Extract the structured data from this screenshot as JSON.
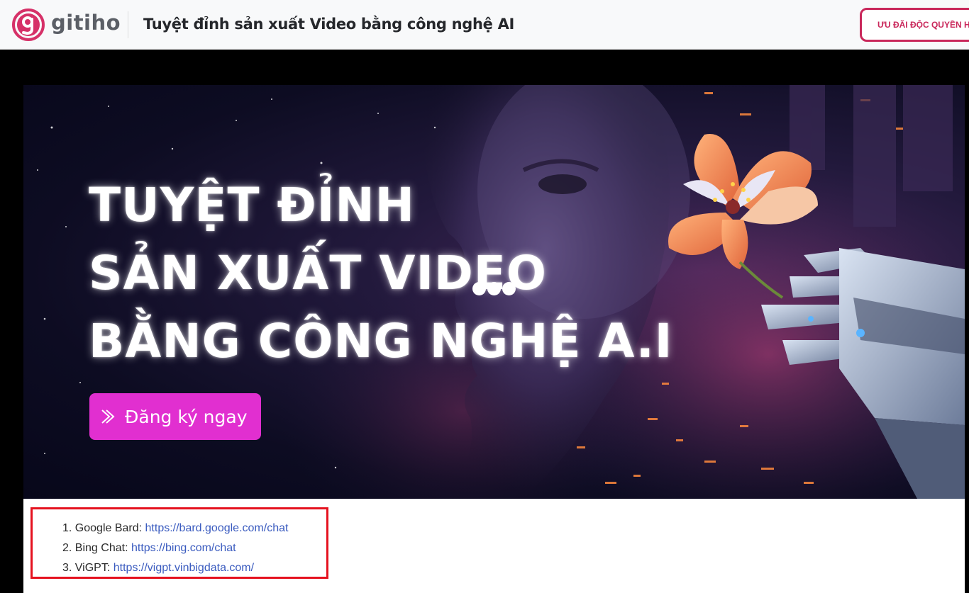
{
  "header": {
    "logo_text": "gitiho",
    "course_title": "Tuyệt đỉnh sản xuất Video bằng công nghệ AI",
    "promo_button": "ƯU ĐÃI ĐỘC QUYỀN H"
  },
  "banner": {
    "headline_line1": "TUYỆT ĐỈNH",
    "headline_line2": "SẢN XUẤT VIDEO",
    "headline_line3": "BẰNG CÔNG NGHỆ A.I",
    "cta_label": "Đăng ký ngay"
  },
  "links": [
    {
      "number": "1.",
      "name": "Google Bard:",
      "url": "https://bard.google.com/chat"
    },
    {
      "number": "2.",
      "name": "Bing Chat:",
      "url": "https://bing.com/chat"
    },
    {
      "number": "3.",
      "name": "ViGPT:",
      "url": "https://vigpt.vinbigdata.com/"
    }
  ],
  "colors": {
    "brand": "#c9285b",
    "cta": "#e12fd0",
    "highlight_border": "#e5121f",
    "link": "#3a5bbf"
  },
  "icons": [
    "gitiho-logo-icon",
    "chevron-right-icon",
    "loading-dots-icon"
  ]
}
